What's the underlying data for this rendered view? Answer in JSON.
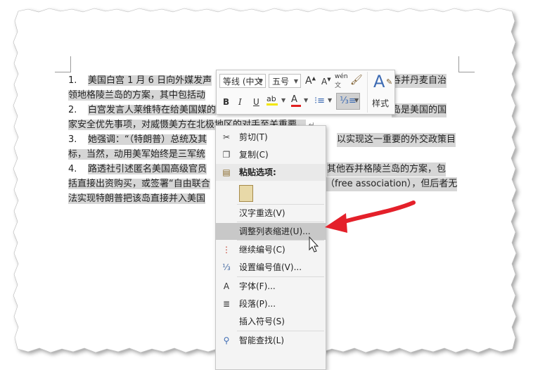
{
  "document": {
    "lines": [
      {
        "num": "1.",
        "text": "美国白宫 1 月 6 日向外媒发声",
        "tail": "吞并丹麦自治"
      },
      {
        "text": "领地格陵兰岛的方案，其中包括动"
      },
      {
        "num": "2.",
        "text": "白宫发言人莱维特在给美国媒的",
        "tail": "岛是美国的国"
      },
      {
        "text": "家安全优先事项，对威慑美方在北极地区的对手至关重要。"
      },
      {
        "num": "3.",
        "text": "她强调：“（特朗普）总统及其",
        "tail": "以实现这一重要的外交政策目"
      },
      {
        "text": "标，当然，动用美军始终是三军统",
        "tail": "”"
      },
      {
        "num": "4.",
        "text": "路透社引述匿名美国高级官员",
        "tail": "其他吞并格陵兰岛的方案，包"
      },
      {
        "text": "括直接出资购买，或签署“自由联合",
        "tail": "（free association），但后者无"
      },
      {
        "text": "法实现特朗普把该岛直接并入美国"
      }
    ]
  },
  "mini_toolbar": {
    "font_name": "等线 (中文",
    "font_size": "五号",
    "grow_font": "A",
    "shrink_font": "A",
    "phonetic": "wén",
    "bold": "B",
    "italic": "I",
    "underline": "U",
    "highlight": "ab",
    "font_color": "A",
    "styles_label": "样式"
  },
  "context_menu": {
    "items": [
      {
        "icon": "scissors-icon",
        "glyph": "✂",
        "label": "剪切(T)"
      },
      {
        "icon": "copy-icon",
        "glyph": "❐",
        "label": "复制(C)"
      },
      {
        "icon": "paste-icon",
        "glyph": "📋",
        "label": "粘贴选项:"
      },
      {
        "icon": "keep-text-only-icon",
        "glyph": "📋",
        "label": ""
      },
      {
        "icon": "",
        "glyph": "",
        "label": "汉字重选(V)"
      },
      {
        "icon": "",
        "glyph": "",
        "label": "调整列表缩进(U)..."
      },
      {
        "icon": "continue-numbering-icon",
        "glyph": "⋮",
        "label": "继续编号(C)"
      },
      {
        "icon": "set-numbering-value-icon",
        "glyph": "⅓",
        "label": "设置编号值(V)..."
      },
      {
        "icon": "font-icon",
        "glyph": "A",
        "label": "字体(F)..."
      },
      {
        "icon": "paragraph-icon",
        "glyph": "≣",
        "label": "段落(P)..."
      },
      {
        "icon": "",
        "glyph": "",
        "label": "插入符号(S)"
      },
      {
        "icon": "smart-lookup-icon",
        "glyph": "⚲",
        "label": "智能查找(L)"
      }
    ]
  },
  "colors": {
    "highlight": "#d6d6d6",
    "selected_item": "#c8c8c8",
    "arrow": "#e4202a",
    "font_color_bar": "#e02020",
    "highlight_bar": "#f2e600"
  }
}
